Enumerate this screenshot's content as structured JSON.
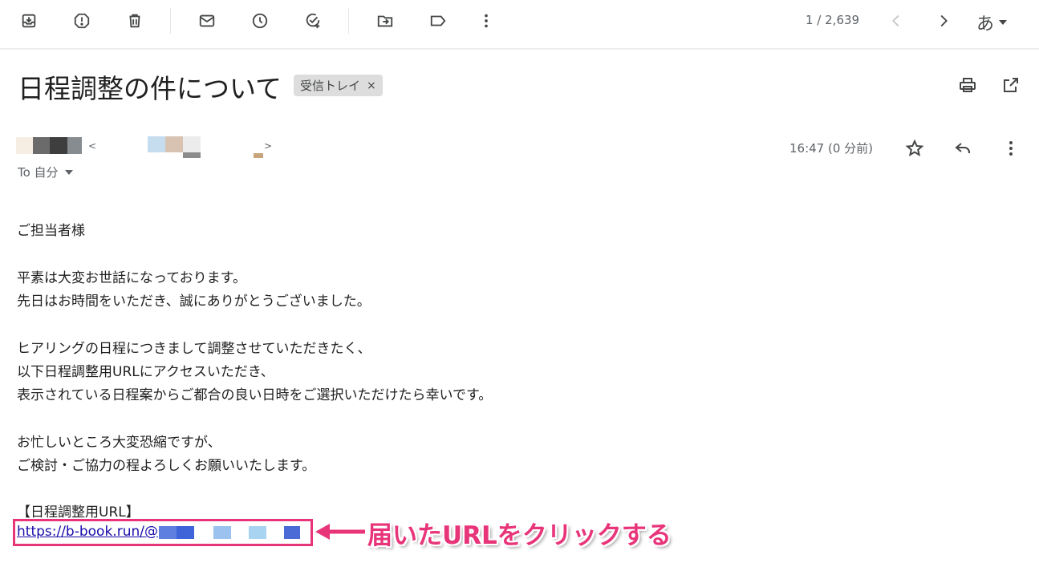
{
  "toolbar": {
    "buttons": [
      {
        "name": "archive-icon"
      },
      {
        "name": "report-spam-icon"
      },
      {
        "name": "delete-icon"
      },
      {
        "name": "mark-unread-icon"
      },
      {
        "name": "snooze-icon"
      },
      {
        "name": "add-to-tasks-icon"
      },
      {
        "name": "move-to-icon"
      },
      {
        "name": "label-icon"
      },
      {
        "name": "more-vert-icon"
      }
    ],
    "pager_text": "1 / 2,639",
    "input_tool_label": "あ"
  },
  "email": {
    "subject": "日程調整の件について",
    "label_chip": "受信トレイ",
    "label_remove": "×",
    "sender_open": "<",
    "sender_close": ">",
    "to_line": "To 自分",
    "timestamp": "16:47 (0 分前)",
    "body_lines": [
      "ご担当者様",
      "平素は大変お世話になっております。",
      "先日はお時間をいただき、誠にありがとうございました。",
      "ヒアリングの日程につきまして調整させていただきたく、",
      "以下日程調整用URLにアクセスいただき、",
      "表示されている日程案からご都合の良い日時をご選択いただけたら幸いです。",
      "お忙しいところ大変恐縮ですが、",
      "ご検討・ご協力の程よろしくお願いいたします。",
      "【日程調整用URL】"
    ],
    "url_text": "https://b-book.run/@"
  },
  "annotation": {
    "text": "届いたURLをクリックする",
    "color": "#e8357a"
  }
}
